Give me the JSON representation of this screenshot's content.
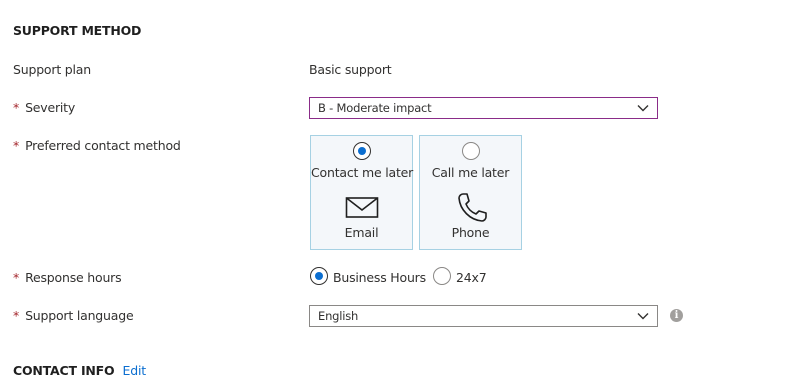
{
  "support_method": {
    "title": "SUPPORT METHOD",
    "support_plan": {
      "label": "Support plan",
      "value": "Basic support"
    },
    "severity": {
      "required_mark": "*",
      "label": "Severity",
      "selected": "B - Moderate impact"
    },
    "contact_method": {
      "required_mark": "*",
      "label": "Preferred contact method",
      "options": [
        {
          "label": "Contact me later",
          "sub": "Email",
          "icon": "envelope-icon",
          "selected": true
        },
        {
          "label": "Call me later",
          "sub": "Phone",
          "icon": "phone-icon",
          "selected": false
        }
      ]
    },
    "response_hours": {
      "required_mark": "*",
      "label": "Response hours",
      "options": [
        {
          "label": "Business Hours",
          "selected": true
        },
        {
          "label": "24x7",
          "selected": false
        }
      ]
    },
    "support_language": {
      "required_mark": "*",
      "label": "Support language",
      "selected": "English",
      "info_icon": "info-icon"
    }
  },
  "contact_info": {
    "title": "CONTACT INFO",
    "edit_label": "Edit"
  },
  "colors": {
    "accent": "#0b6ed0",
    "required": "#a4262c",
    "focus_border": "#8a2c88",
    "card_border": "#a6d1e3"
  }
}
